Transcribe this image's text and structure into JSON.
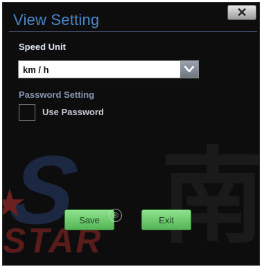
{
  "window": {
    "title": "View Setting",
    "close_label": "✕"
  },
  "speed_unit": {
    "label": "Speed Unit",
    "selected": "km / h"
  },
  "password": {
    "section_label": "Password Setting",
    "checkbox_label": "Use Password",
    "checked": false
  },
  "buttons": {
    "save": "Save",
    "exit": "Exit"
  },
  "background": {
    "brand_letter": "S",
    "brand_text": "STAR",
    "brand_hanzi": "南",
    "registered_mark": "®"
  },
  "colors": {
    "title": "#4a86c8",
    "button": "#6fcf6f",
    "panel": "#0d0d0d"
  }
}
